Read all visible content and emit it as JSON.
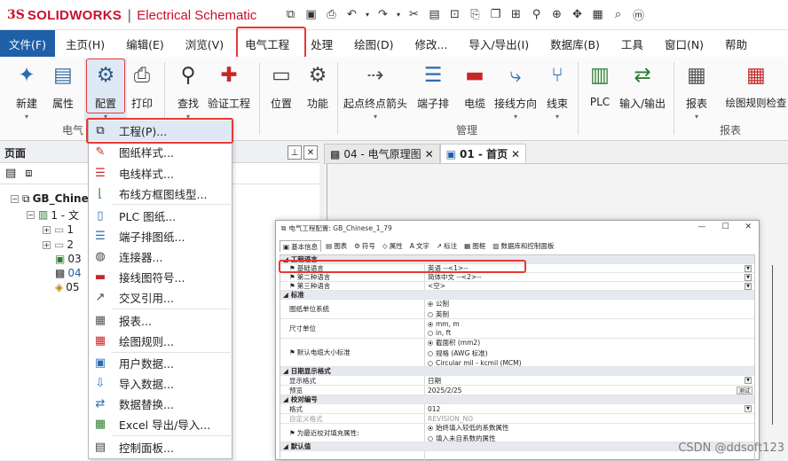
{
  "app": {
    "logo_mark": "3S",
    "logo_brand": "SOLIDWORKS",
    "logo_separator": "|",
    "logo_product": "Electrical Schematic"
  },
  "quick_access_icons": [
    "copy-icon",
    "save-icon",
    "print-icon",
    "undo-icon",
    "undo-dropdown-icon",
    "redo-icon",
    "redo-dropdown-icon",
    "cut-icon",
    "paste-icon",
    "copy-format-icon",
    "clipboard-icon",
    "duplicate-icon",
    "move-icon",
    "zoom-icon",
    "search-icon",
    "pan-icon",
    "grid-icon",
    "find-icon",
    "user-icon"
  ],
  "menu": {
    "items": [
      "文件(F)",
      "主页(H)",
      "编辑(E)",
      "浏览(V)",
      "电气工程",
      "处理",
      "绘图(D)",
      "修改...",
      "导入/导出(I)",
      "数据库(B)",
      "工具",
      "窗口(N)",
      "帮助"
    ]
  },
  "ribbon": {
    "buttons": [
      {
        "label": "新建",
        "icon": "new-icon"
      },
      {
        "label": "属性",
        "icon": "properties-icon"
      },
      {
        "label": "配置",
        "icon": "configure-icon"
      },
      {
        "label": "打印",
        "icon": "print-icon"
      },
      {
        "label": "查找",
        "icon": "search-icon"
      },
      {
        "label": "验证工程",
        "icon": "validate-icon"
      },
      {
        "label": "位置",
        "icon": "location-icon"
      },
      {
        "label": "功能",
        "icon": "function-icon"
      },
      {
        "label": "起点终点箭头",
        "icon": "arrow-icon"
      },
      {
        "label": "端子排",
        "icon": "terminal-strip-icon"
      },
      {
        "label": "电缆",
        "icon": "cable-icon"
      },
      {
        "label": "接线方向",
        "icon": "wiring-direction-icon"
      },
      {
        "label": "线束",
        "icon": "harness-icon"
      },
      {
        "label": "PLC",
        "icon": "plc-icon"
      },
      {
        "label": "输入/输出",
        "icon": "io-icon"
      },
      {
        "label": "报表",
        "icon": "report-icon"
      },
      {
        "label": "绘图规则检查",
        "icon": "drawing-rules-icon"
      }
    ],
    "groups": {
      "electrical": "电气",
      "manage": "管理",
      "report": "报表"
    }
  },
  "left_panel": {
    "title": "页面",
    "tree": [
      {
        "text": "GB_Chine"
      },
      {
        "text": "1 - 文"
      },
      {
        "text": "1"
      },
      {
        "text": "2"
      },
      {
        "text": "03"
      },
      {
        "text": "04"
      },
      {
        "text": "05"
      }
    ]
  },
  "doc_tabs": [
    {
      "label": "04 - 电气原理图"
    },
    {
      "label": "01 - 首页"
    }
  ],
  "dropdown": {
    "items": [
      {
        "label": "工程(P)...",
        "icon": "project-icon"
      },
      {
        "label": "图纸样式...",
        "icon": "drawing-style-icon"
      },
      {
        "label": "电线样式...",
        "icon": "wire-style-icon"
      },
      {
        "label": "布线方框图线型...",
        "icon": "line-style-icon"
      },
      {
        "label": "PLC 图纸...",
        "icon": "plc-drawing-icon"
      },
      {
        "label": "端子排图纸...",
        "icon": "terminal-drawing-icon"
      },
      {
        "label": "连接器...",
        "icon": "connector-icon"
      },
      {
        "label": "接线图符号...",
        "icon": "wiring-symbol-icon"
      },
      {
        "label": "交叉引用...",
        "icon": "cross-reference-icon"
      },
      {
        "label": "报表...",
        "icon": "report-icon"
      },
      {
        "label": "绘图规则...",
        "icon": "drawing-rules-icon"
      },
      {
        "label": "用户数据...",
        "icon": "user-data-icon"
      },
      {
        "label": "导入数据...",
        "icon": "import-data-icon"
      },
      {
        "label": "数据替换...",
        "icon": "data-replace-icon"
      },
      {
        "label": "Excel 导出/导入...",
        "icon": "excel-icon"
      },
      {
        "label": "控制面板...",
        "icon": "control-panel-icon"
      }
    ]
  },
  "dialog": {
    "title": "电气工程配置: GB_Chinese_1_79",
    "tabs": [
      "基本信息",
      "图表",
      "符号",
      "属性",
      "文字",
      "标注",
      "图框",
      "数据库和控制面板"
    ],
    "sections": {
      "project_language": "工程语言",
      "standard": "标准",
      "date_format": "日期显示格式",
      "revision": "校对编号",
      "default_values": "默认值"
    },
    "rows": {
      "base_language": {
        "name": "基础语言",
        "value": "英语 --<1>--"
      },
      "second_language": {
        "name": "第二种语言",
        "value": "简体中文 --<2>--"
      },
      "third_language": {
        "name": "第三种语言",
        "value": "<空>"
      },
      "unit_system": {
        "name": "图纸单位系统",
        "options": [
          "公制",
          "英制"
        ]
      },
      "size_unit": {
        "name": "尺寸单位",
        "options": [
          "mm, m",
          "in, ft"
        ]
      },
      "wire_size": {
        "name": "默认电缆大小标准",
        "options": [
          "截面积 (mm2)",
          "规格 (AWG 标准)",
          "Circular mil - kcmil (MCM)"
        ]
      },
      "display_format": {
        "name": "显示格式",
        "value": "日期"
      },
      "preview": {
        "name": "预览",
        "value": "2025/2/25",
        "button": "测试"
      },
      "rev_format": {
        "name": "格式",
        "value": "012"
      },
      "custom_format": {
        "name": "自定义格式",
        "value": "REVISION_NO"
      },
      "fill_attr": {
        "name": "为最近校对填充属性:",
        "options": [
          "始终填入较低的系数属性",
          "填入未自系数的属性"
        ]
      }
    }
  },
  "watermark": "CSDN @ddsoft123"
}
